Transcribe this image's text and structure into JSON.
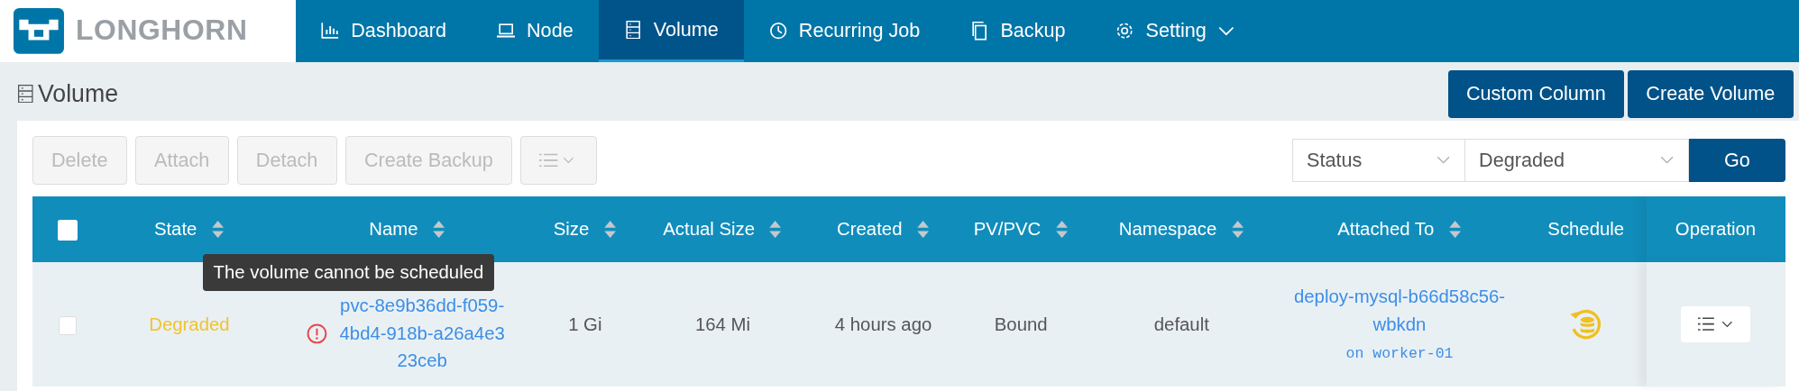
{
  "brand": {
    "name": "LONGHORN"
  },
  "nav": [
    {
      "label": "Dashboard",
      "selected": false
    },
    {
      "label": "Node",
      "selected": false
    },
    {
      "label": "Volume",
      "selected": true
    },
    {
      "label": "Recurring Job",
      "selected": false
    },
    {
      "label": "Backup",
      "selected": false
    },
    {
      "label": "Setting",
      "selected": false,
      "dropdown": true
    }
  ],
  "page": {
    "title": "Volume"
  },
  "header_buttons": [
    "Custom Column",
    "Create Volume"
  ],
  "toolbar": {
    "buttons": [
      {
        "label": "Delete",
        "disabled": true
      },
      {
        "label": "Attach",
        "disabled": true
      },
      {
        "label": "Detach",
        "disabled": true
      },
      {
        "label": "Create Backup",
        "disabled": true
      }
    ],
    "menu_disabled": true
  },
  "filter": {
    "field": "Status",
    "value": "Degraded",
    "button": "Go"
  },
  "table": {
    "select_all": {
      "checked": false
    },
    "columns": [
      {
        "label": "State",
        "sortable": true
      },
      {
        "label": "Name",
        "sortable": true
      },
      {
        "label": "Size",
        "sortable": true
      },
      {
        "label": "Actual Size",
        "sortable": true
      },
      {
        "label": "Created",
        "sortable": true
      },
      {
        "label": "PV/PVC",
        "sortable": true
      },
      {
        "label": "Namespace",
        "sortable": true
      },
      {
        "label": "Attached To",
        "sortable": true
      },
      {
        "label": "Schedule",
        "sortable": false
      },
      {
        "label": "Operation",
        "sortable": false
      }
    ],
    "rows": [
      {
        "checked": false,
        "state": "Degraded",
        "color": "#f0c330",
        "name": "pvc-8e9b36dd-f059-4bd4-918b-a26a4e323ceb",
        "warning": true,
        "tooltip": "The volume cannot be scheduled",
        "size": "1 Gi",
        "actual_size": "164 Mi",
        "created": "4 hours ago",
        "pv_pvc": "Bound",
        "namespace": "default",
        "attached_to": "deploy-mysql-b66d58c56-wbkdn",
        "node": "on worker-01",
        "schedule_warning": true
      }
    ]
  }
}
